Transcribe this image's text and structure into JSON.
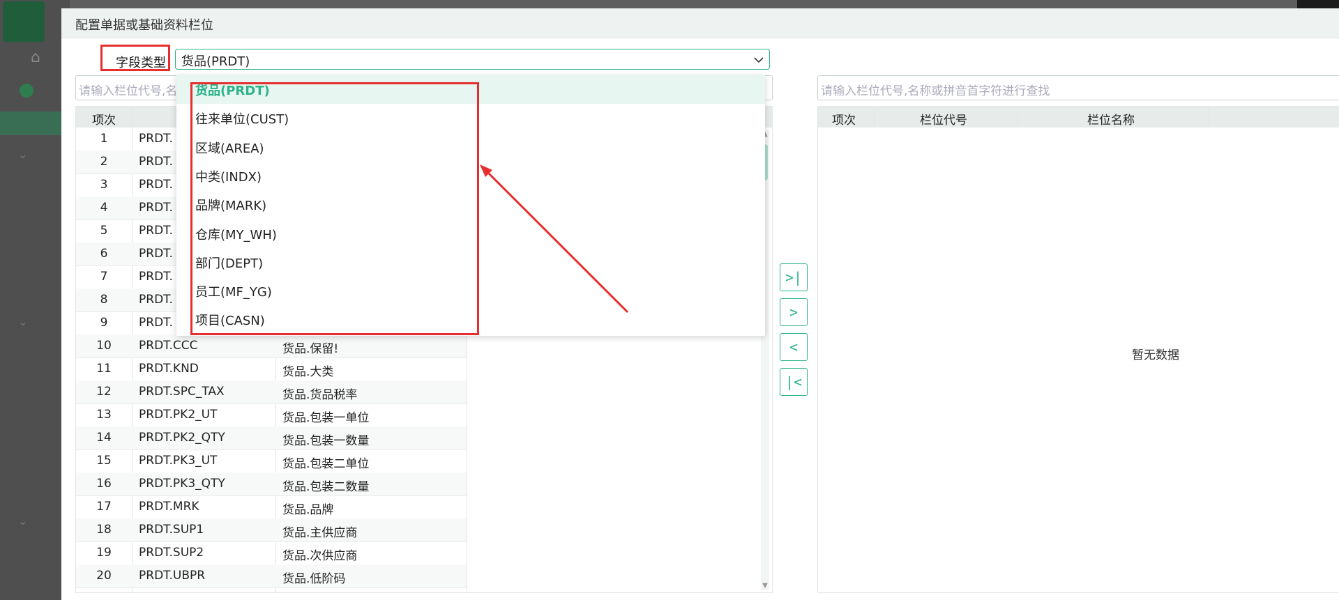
{
  "dialog": {
    "title": "配置单据或基础资料栏位"
  },
  "field_type": {
    "label": "字段类型",
    "value": "货品(PRDT)"
  },
  "left_search": {
    "placeholder": "请输入栏位代号,名"
  },
  "right_search": {
    "placeholder": "请输入栏位代号,名称或拼音首字符进行查找"
  },
  "left_table": {
    "headers": [
      "项次"
    ],
    "rows": [
      {
        "idx": "1",
        "code": "PRDT.",
        "name": ""
      },
      {
        "idx": "2",
        "code": "PRDT.",
        "name": ""
      },
      {
        "idx": "3",
        "code": "PRDT.",
        "name": ""
      },
      {
        "idx": "4",
        "code": "PRDT.",
        "name": ""
      },
      {
        "idx": "5",
        "code": "PRDT.",
        "name": ""
      },
      {
        "idx": "6",
        "code": "PRDT.",
        "name": ""
      },
      {
        "idx": "7",
        "code": "PRDT.",
        "name": ""
      },
      {
        "idx": "8",
        "code": "PRDT.",
        "name": ""
      },
      {
        "idx": "9",
        "code": "PRDT.",
        "name": ""
      },
      {
        "idx": "10",
        "code": "PRDT.CCC",
        "name": "货品.保留!"
      },
      {
        "idx": "11",
        "code": "PRDT.KND",
        "name": "货品.大类"
      },
      {
        "idx": "12",
        "code": "PRDT.SPC_TAX",
        "name": "货品.货品税率"
      },
      {
        "idx": "13",
        "code": "PRDT.PK2_UT",
        "name": "货品.包装一单位"
      },
      {
        "idx": "14",
        "code": "PRDT.PK2_QTY",
        "name": "货品.包装一数量"
      },
      {
        "idx": "15",
        "code": "PRDT.PK3_UT",
        "name": "货品.包装二单位"
      },
      {
        "idx": "16",
        "code": "PRDT.PK3_QTY",
        "name": "货品.包装二数量"
      },
      {
        "idx": "17",
        "code": "PRDT.MRK",
        "name": "货品.品牌"
      },
      {
        "idx": "18",
        "code": "PRDT.SUP1",
        "name": "货品.主供应商"
      },
      {
        "idx": "19",
        "code": "PRDT.SUP2",
        "name": "货品.次供应商"
      },
      {
        "idx": "20",
        "code": "PRDT.UBPR",
        "name": "货品.低阶码"
      }
    ]
  },
  "right_table": {
    "headers": [
      "项次",
      "栏位代号",
      "栏位名称"
    ],
    "empty_text": "暂无数据"
  },
  "transfer_buttons": [
    ">|",
    ">",
    "<",
    "|<"
  ],
  "dropdown": {
    "options": [
      "货品(PRDT)",
      "往来单位(CUST)",
      "区域(AREA)",
      "中类(INDX)",
      "品牌(MARK)",
      "仓库(MY_WH)",
      "部门(DEPT)",
      "员工(MF_YG)",
      "项目(CASN)"
    ],
    "selected_index": 0
  },
  "colors": {
    "accent": "#2bb38a",
    "annotation": "#e62e2e"
  }
}
